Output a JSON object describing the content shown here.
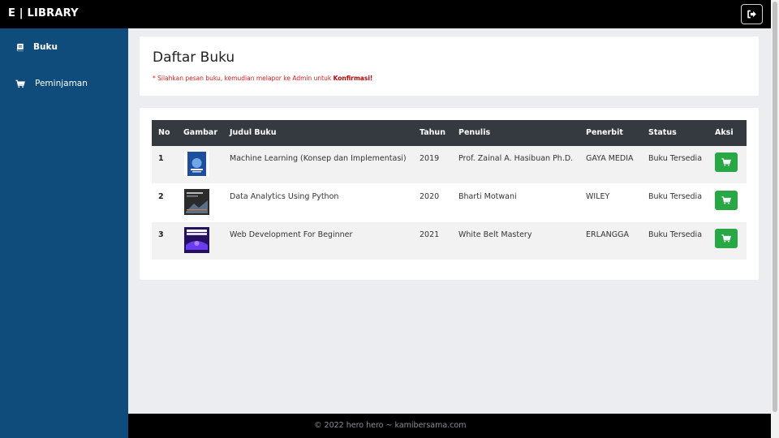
{
  "header": {
    "brand": "E | LIBRARY",
    "logout_icon": "sign-out-icon"
  },
  "sidebar": {
    "items": [
      {
        "label": "Buku",
        "icon": "book-icon",
        "active": true
      },
      {
        "label": "Peminjaman",
        "icon": "cart-icon",
        "active": false
      }
    ]
  },
  "main": {
    "title": "Daftar Buku",
    "notice_prefix": "* Silahkan pesan buku, kemudian melapor ke Admin untuk ",
    "notice_bold": "Konfirmasi!"
  },
  "table": {
    "headers": [
      "No",
      "Gambar",
      "Judul Buku",
      "Tahun",
      "Penulis",
      "Penerbit",
      "Status",
      "Aksi"
    ],
    "rows": [
      {
        "no": "1",
        "title": "Machine Learning (Konsep dan Implementasi)",
        "year": "2019",
        "author": "Prof. Zainal A. Hasibuan Ph.D.",
        "publisher": "GAYA MEDIA",
        "status": "Buku Tersedia"
      },
      {
        "no": "2",
        "title": "Data Analytics Using Python",
        "year": "2020",
        "author": "Bharti Motwani",
        "publisher": "WILEY",
        "status": "Buku Tersedia"
      },
      {
        "no": "3",
        "title": "Web Development For Beginner",
        "year": "2021",
        "author": "White Belt Mastery",
        "publisher": "ERLANGGA",
        "status": "Buku Tersedia"
      }
    ]
  },
  "footer": {
    "text": "© 2022 hero hero ~ kamibersama.com"
  },
  "colors": {
    "sidebar": "#0f4c7b",
    "table_head": "#343a40",
    "action": "#28a745",
    "notice": "#e01b1b"
  }
}
